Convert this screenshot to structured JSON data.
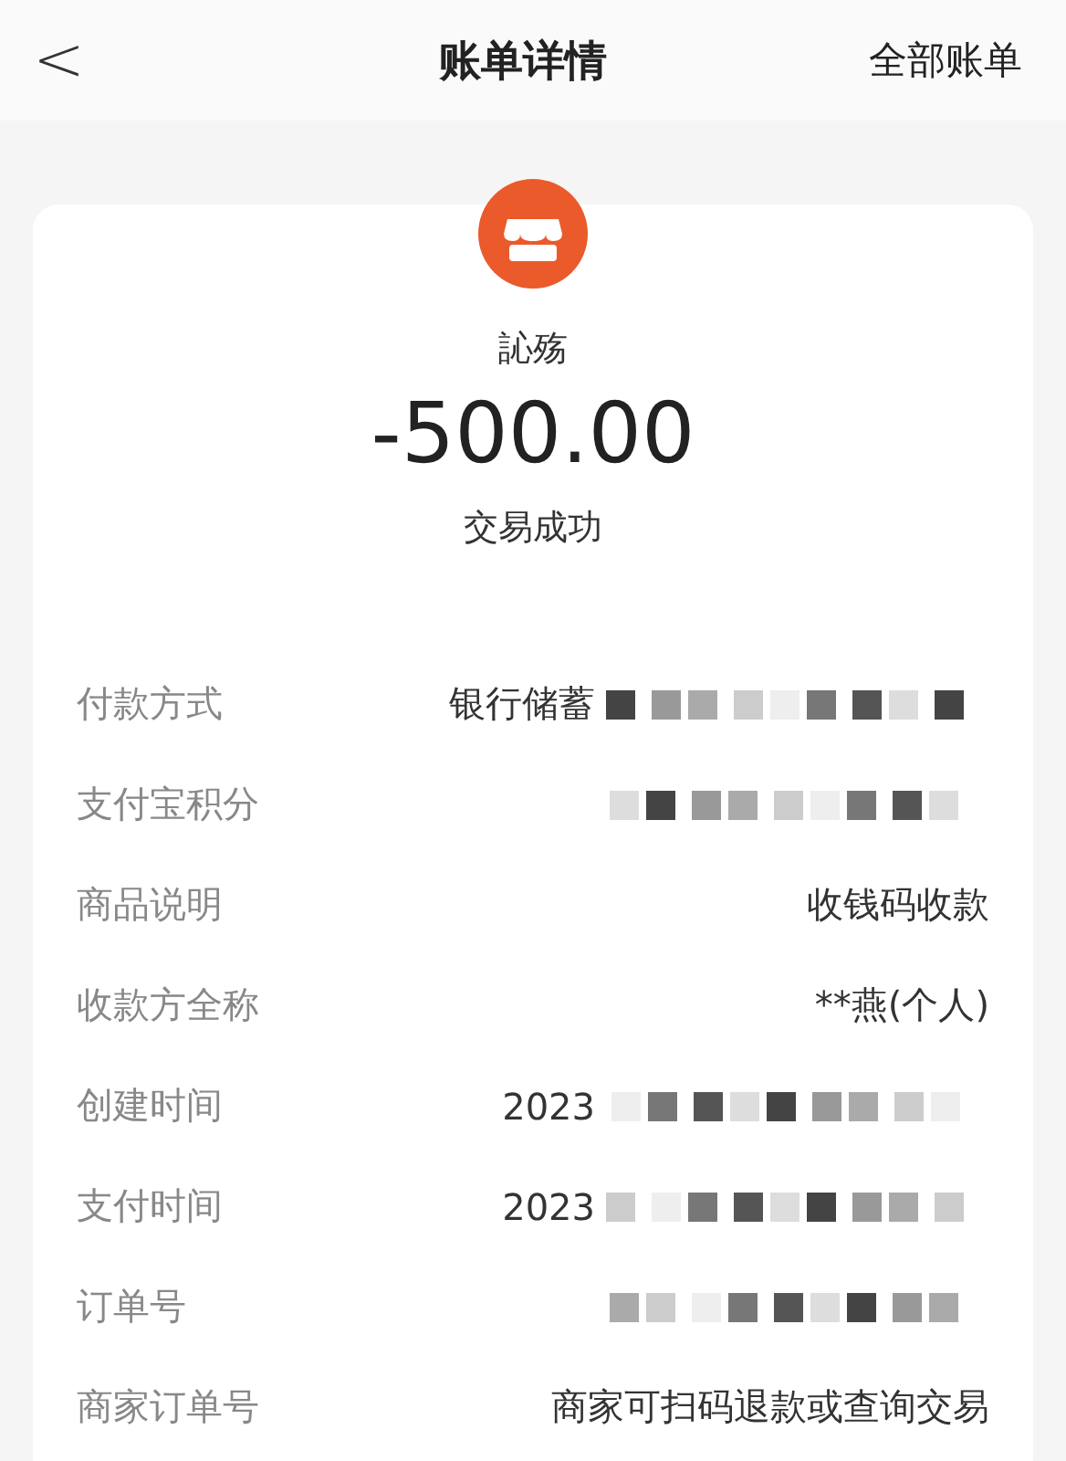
{
  "nav": {
    "back": "<",
    "title": "账单详情",
    "action": "全部账单"
  },
  "summary": {
    "merchant": "訫殇",
    "amount": "-500.00",
    "status": "交易成功"
  },
  "rows": [
    {
      "label": "付款方式",
      "value": "银行储蓄",
      "redacted": true
    },
    {
      "label": "支付宝积分",
      "redacted": true
    },
    {
      "label": "商品说明",
      "value": "收钱码收款",
      "redacted": false
    },
    {
      "label": "收款方全称",
      "value": "**燕(个人)",
      "redacted": false
    },
    {
      "label": "创建时间",
      "value": "2023",
      "redacted": true
    },
    {
      "label": "支付时间",
      "value": "2023",
      "redacted": true
    },
    {
      "label": "订单号",
      "redacted": true
    },
    {
      "label": "商家订单号",
      "value": "商家可扫码退款或查询交易",
      "redacted": false
    }
  ]
}
